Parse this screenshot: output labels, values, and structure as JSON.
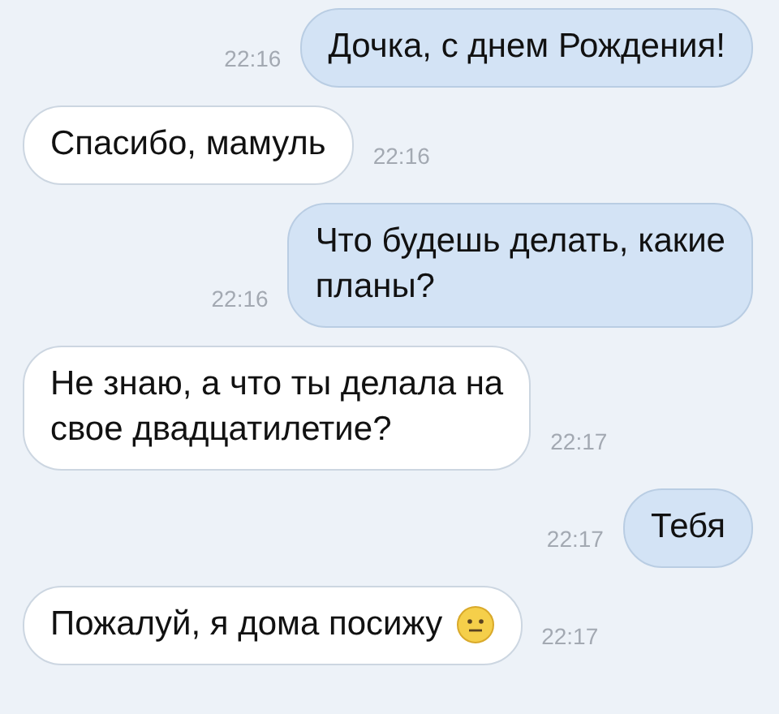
{
  "messages": [
    {
      "kind": "out",
      "text": "Дочка, с днем Рождения!",
      "time": "22:16",
      "emoji": false
    },
    {
      "kind": "in",
      "text": "Спасибо, мамуль",
      "time": "22:16",
      "emoji": false
    },
    {
      "kind": "out",
      "text": "Что будешь делать, какие\nпланы?",
      "time": "22:16",
      "emoji": false
    },
    {
      "kind": "in",
      "text": "Не знаю, а что ты делала на\nсвое двадцатилетие?",
      "time": "22:17",
      "emoji": false
    },
    {
      "kind": "out",
      "text": "Тебя",
      "time": "22:17",
      "emoji": false
    },
    {
      "kind": "in",
      "text": "Пожалуй, я дома посижу",
      "time": "22:17",
      "emoji": true
    }
  ]
}
